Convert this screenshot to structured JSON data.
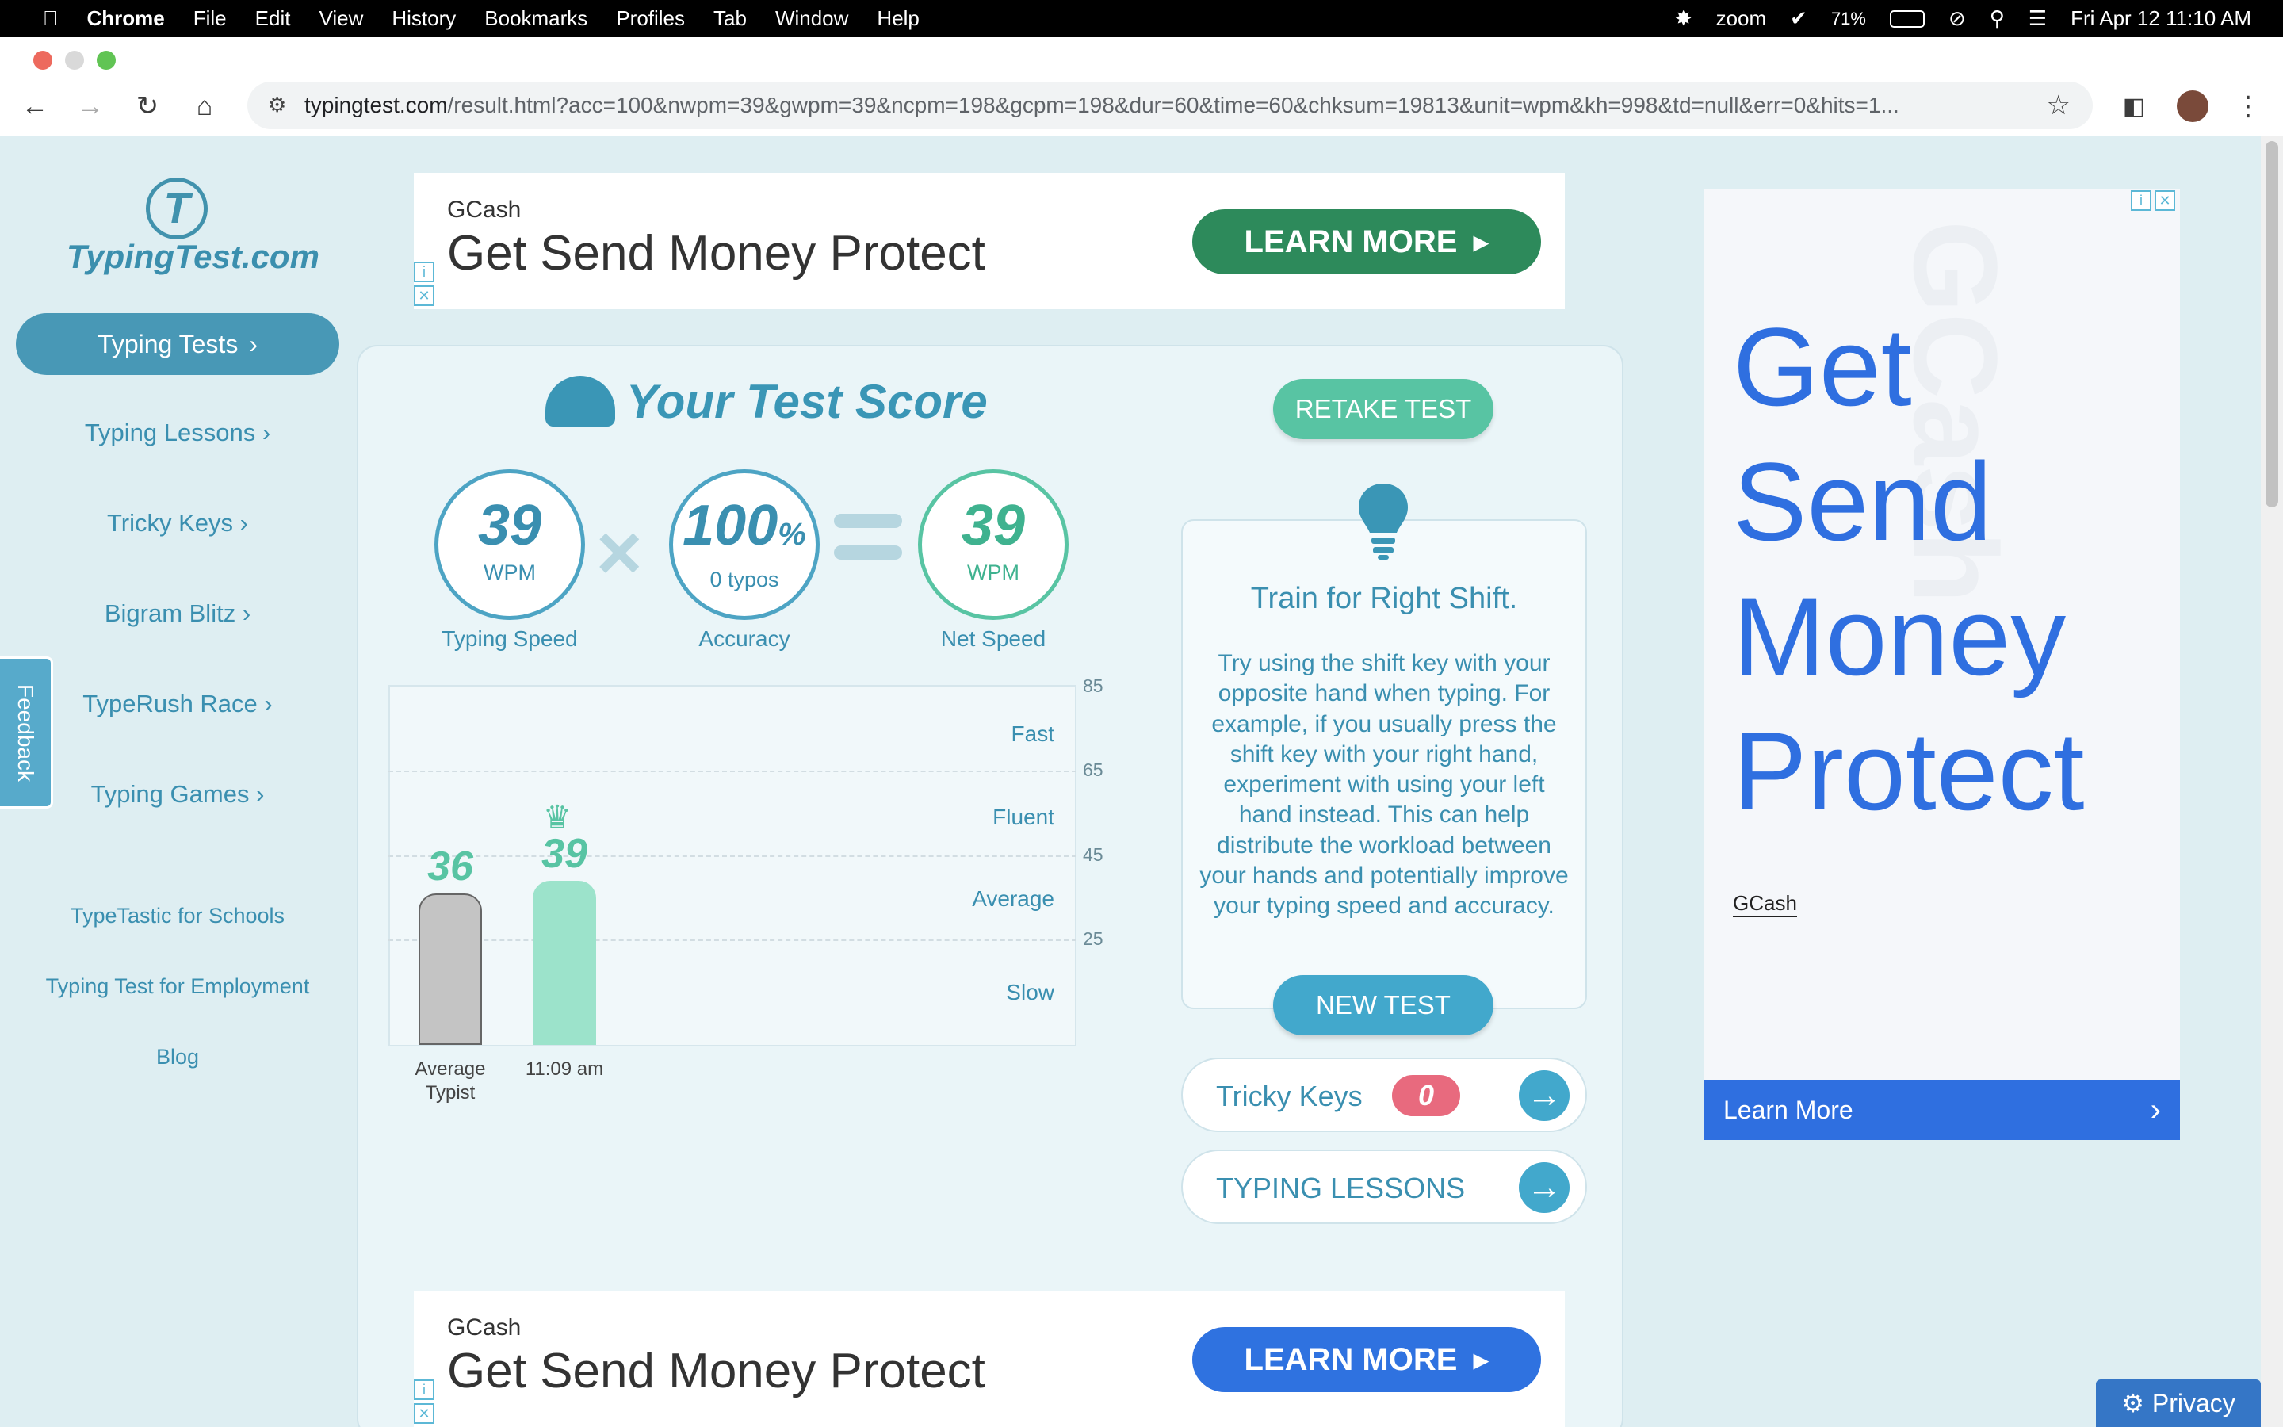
{
  "menubar": {
    "app": "Chrome",
    "items": [
      "File",
      "Edit",
      "View",
      "History",
      "Bookmarks",
      "Profiles",
      "Tab",
      "Window",
      "Help"
    ],
    "zoom": "zoom",
    "battery": "71%",
    "datetime": "Fri Apr 12  11:10 AM"
  },
  "browser": {
    "url_domain": "typingtest.com",
    "url_rest": "/result.html?acc=100&nwpm=39&gwpm=39&ncpm=198&gcpm=198&dur=60&time=60&chksum=19813&unit=wpm&kh=998&td=null&err=0&hits=1..."
  },
  "sidebar": {
    "logo_text": "TypingTest.com",
    "logo_mark": "T",
    "active_item": "Typing Tests",
    "items": [
      "Typing Lessons",
      "Tricky Keys",
      "Bigram Blitz",
      "TypeRush Race",
      "Typing Games"
    ],
    "links": [
      "TypeTastic for Schools",
      "Typing Test for Employment",
      "Blog"
    ],
    "feedback": "Feedback"
  },
  "ads": {
    "top": {
      "brand": "GCash",
      "headline": "Get Send Money Protect",
      "cta": "LEARN MORE",
      "cta_color": "#2d8a5b"
    },
    "bottom": {
      "brand": "GCash",
      "headline": "Get Send Money Protect",
      "cta": "LEARN MORE",
      "cta_color": "#2f72e0"
    },
    "side": {
      "headline_lines": [
        "Get",
        "Send",
        "Money",
        "Protect"
      ],
      "brand": "GCash",
      "cta": "Learn More",
      "watermark": "GCash"
    }
  },
  "score": {
    "title": "Your Test Score",
    "typing_speed": {
      "value": "39",
      "unit": "WPM",
      "label": "Typing Speed"
    },
    "accuracy": {
      "value": "100",
      "pct": "%",
      "sub": "0 typos",
      "label": "Accuracy"
    },
    "net_speed": {
      "value": "39",
      "unit": "WPM",
      "label": "Net Speed"
    },
    "retake": "RETAKE TEST",
    "new_test": "NEW TEST"
  },
  "chart_data": {
    "type": "bar",
    "categories": [
      "Average Typist",
      "11:09 am"
    ],
    "values": [
      36,
      39
    ],
    "ylim": [
      0,
      85
    ],
    "yticks": [
      85,
      65,
      45,
      25
    ],
    "zones": [
      "Fast",
      "Fluent",
      "Average",
      "Slow"
    ],
    "colors": [
      "#c4c4c4",
      "#9ce3cb"
    ],
    "label_colors": [
      "#58c4a3",
      "#58c4a3"
    ]
  },
  "tip": {
    "title": "Train for Right Shift.",
    "body": "Try using the shift key with your opposite hand when typing. For example, if you usually press the shift key with your right hand, experiment with using your left hand instead. This can help distribute the workload between your hands and potentially improve your typing speed and accuracy."
  },
  "links": {
    "tricky_keys": {
      "label": "Tricky Keys",
      "badge": "0"
    },
    "typing_lessons": {
      "label": "TYPING LESSONS"
    }
  },
  "privacy": "Privacy"
}
